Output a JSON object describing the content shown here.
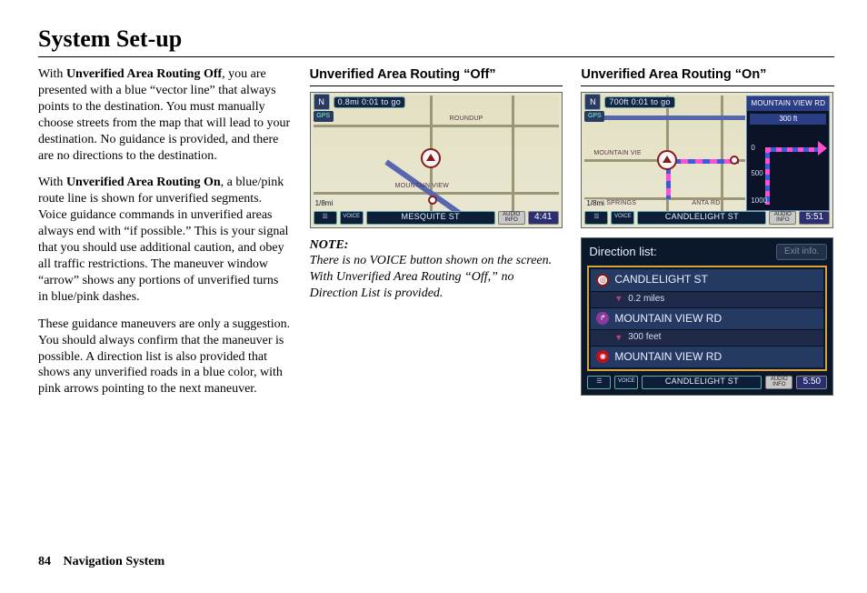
{
  "page": {
    "title": "System Set-up",
    "number": "84",
    "section": "Navigation System"
  },
  "col1": {
    "p1a": "With ",
    "p1b": "Unverified Area Routing Off",
    "p1c": ", you are presented with a blue “vector line” that always points to the destination. You must manually choose streets from the map that will lead to your destination. No guidance is provided, and there are no directions to the destination.",
    "p2a": "With ",
    "p2b": "Unverified Area Routing On",
    "p2c": ", a blue/pink route line is shown for unverified segments. Voice guidance commands in unverified areas always end with “if possible.” This is your signal that you should use additional caution, and obey all traffic restrictions. The maneuver window “arrow” shows any portions of unverified turns in blue/pink dashes.",
    "p3": "These guidance maneuvers are only a suggestion. You should always confirm that the maneuver is possible. A direction list is also provided that shows any unverified roads in a blue color, with pink arrows pointing to the next maneuver."
  },
  "col2": {
    "heading": "Unverified Area Routing “Off”",
    "shot": {
      "compass": "N",
      "gps": "GPS",
      "distToGo": "0.8mi 0:01 to go",
      "roads": {
        "roundup": "ROUNDUP",
        "mountainView": "MOUNTAIN VIEW"
      },
      "scale": "1/8mi",
      "voice": "VOICE",
      "street": "MESQUITE ST",
      "audio": "AUDIO INFO",
      "clock": "4:41"
    },
    "noteHead": "NOTE:",
    "noteBody": "There is no VOICE button shown on the screen. With Unverified Area Routing “Off,” no Direction List is provided."
  },
  "col3": {
    "heading": "Unverified Area Routing “On”",
    "shot": {
      "compass": "N",
      "gps": "GPS",
      "distToGo": "700ft 0:01 to go",
      "roads": {
        "mountainView": "MOUNTAIN VIE",
        "ockSprings": "OCK SPRINGS",
        "antaRd": "ANTA RD"
      },
      "scale": "1/8mi",
      "voice": "VOICE",
      "street": "CANDLELIGHT ST",
      "audio": "AUDIO INFO",
      "clock": "5:51",
      "maneuver": {
        "road": "MOUNTAIN VIEW RD",
        "dist": "300 ft",
        "ticks": {
          "t0": "0",
          "t500": "500",
          "t1000": "1000"
        }
      }
    },
    "dirlist": {
      "title": "Direction list:",
      "exit": "Exit info.",
      "rows": [
        {
          "icon": "tgt",
          "text": "CANDLELIGHT ST"
        },
        {
          "sub": true,
          "text": "0.2 miles"
        },
        {
          "icon": "turn",
          "text": "MOUNTAIN VIEW RD"
        },
        {
          "sub": true,
          "text": "300 feet"
        },
        {
          "icon": "dest",
          "text": "MOUNTAIN VIEW RD"
        }
      ],
      "voice": "VOICE",
      "street": "CANDLELIGHT ST",
      "audio": "AUDIO INFO",
      "clock": "5:50"
    }
  }
}
